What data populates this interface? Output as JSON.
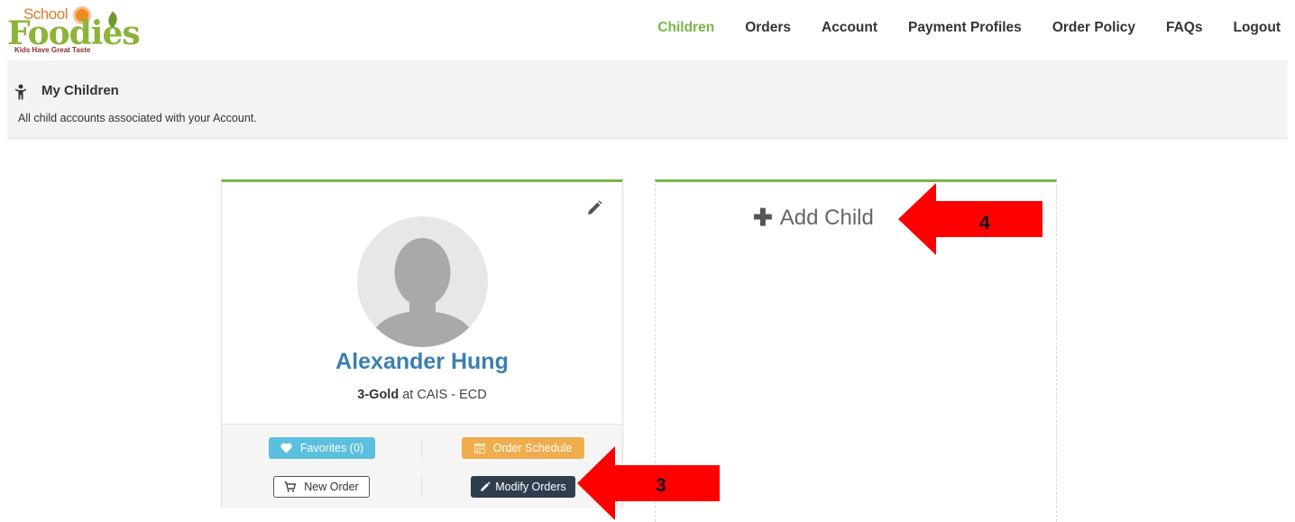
{
  "brand": {
    "logo_top": "School",
    "logo_main": "Foodies",
    "tagline": "Kids Have Great Taste"
  },
  "nav": {
    "items": [
      {
        "label": "Children",
        "active": true
      },
      {
        "label": "Orders",
        "active": false
      },
      {
        "label": "Account",
        "active": false
      },
      {
        "label": "Payment Profiles",
        "active": false
      },
      {
        "label": "Order Policy",
        "active": false
      },
      {
        "label": "FAQs",
        "active": false
      },
      {
        "label": "Logout",
        "active": false
      }
    ],
    "active_color": "#7ab648"
  },
  "page": {
    "title": "My Children",
    "description": "All child accounts associated with your Account.",
    "icon": "child-icon"
  },
  "child": {
    "name": "Alexander Hung",
    "grade": "3-Gold",
    "at_word": "at",
    "school": "CAIS - ECD",
    "avatar_icon": "default-avatar-icon",
    "edit_icon": "pencil-icon",
    "buttons": {
      "favorites": "Favorites (0)",
      "order_schedule": "Order Schedule",
      "new_order": "New Order",
      "modify_orders": "Modify Orders"
    }
  },
  "add_child": {
    "label": "Add Child",
    "icon": "plus-icon"
  },
  "annotations": [
    {
      "label": "3",
      "color": "#ff0000"
    },
    {
      "label": "4",
      "color": "#ff0000"
    }
  ],
  "colors": {
    "accent_green": "#7ab648",
    "name_blue": "#3c7fb0",
    "info_btn": "#5bc0de",
    "warning_btn": "#f0ad4e",
    "dark_btn": "#2f3e4e"
  }
}
